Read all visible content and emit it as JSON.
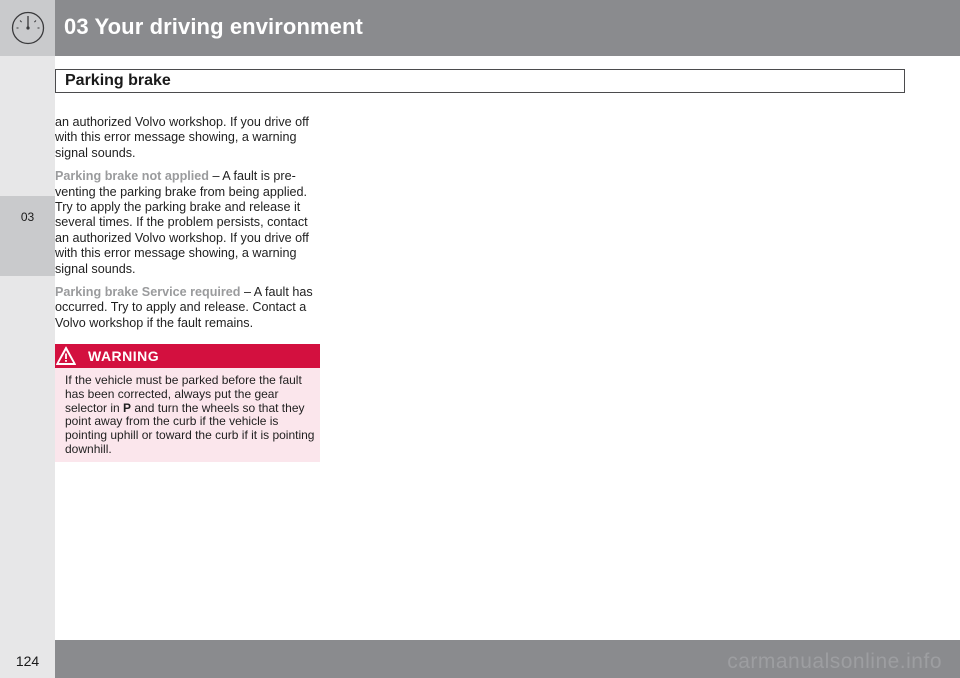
{
  "header": {
    "chapter_title": "03 Your driving environment",
    "icon": "gauge-icon",
    "color": "#8a8b8e"
  },
  "sidebar": {
    "chapter_tab": "03"
  },
  "section": {
    "title": "Parking brake"
  },
  "body": {
    "para1": "an authorized Volvo workshop. If you drive off with this error message showing, a warning signal sounds.",
    "msg2_name": "Parking brake not applied",
    "msg2_text": " – A fault is pre-venting the parking brake from being applied. Try to apply the parking brake and release it several times. If the problem persists, contact an authorized Volvo workshop. If you drive off with this error message showing, a warning signal sounds.",
    "msg3_name": "Parking brake Service required",
    "msg3_text": " – A fault has occurred. Try to apply and release. Contact a Volvo workshop if the fault remains."
  },
  "warning": {
    "title": "WARNING",
    "icon": "warning-triangle-icon",
    "text_before": "If the vehicle must be parked before the fault has been corrected, always put the gear selector in ",
    "gear": "P",
    "text_after": " and turn the wheels so that they point away from the curb if the vehicle is pointing uphill or toward the curb if it is pointing downhill.",
    "color": "#d3103f"
  },
  "footer": {
    "page_number": "124",
    "watermark": "carmanualsonline.info"
  }
}
